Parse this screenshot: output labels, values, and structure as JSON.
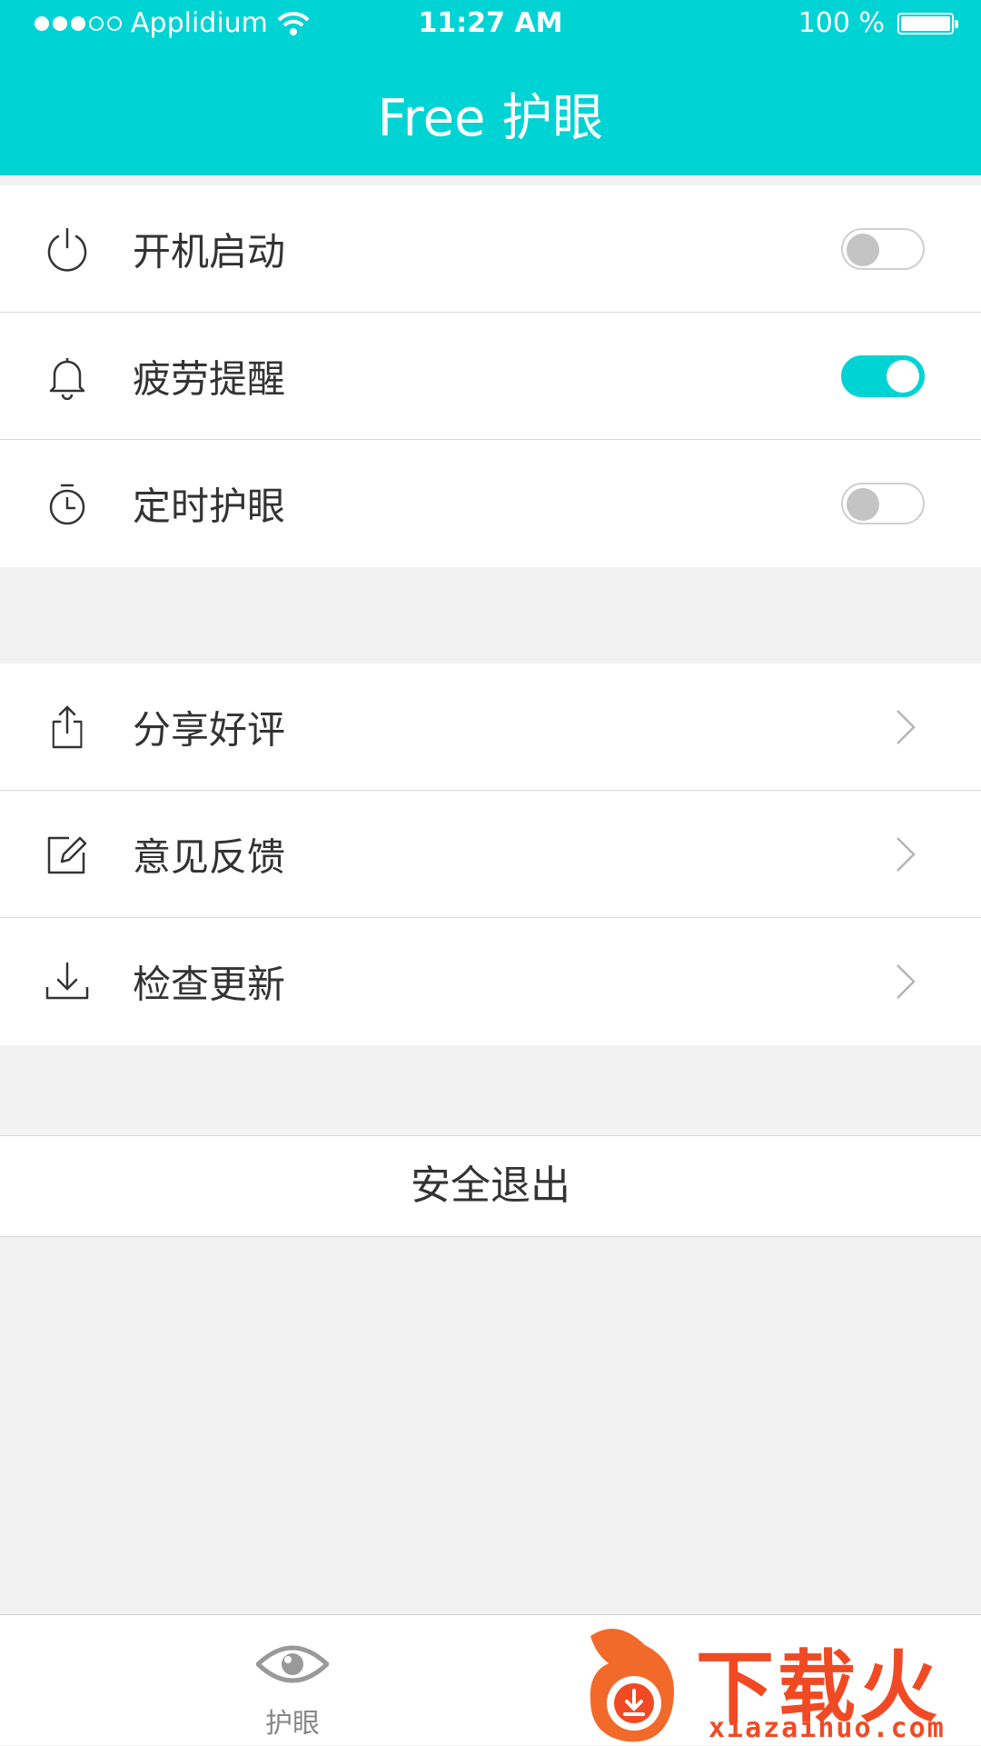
{
  "status_bar": {
    "carrier": "Applidium",
    "time": "11:27 AM",
    "battery": "100 %"
  },
  "header": {
    "title": "Free 护眼"
  },
  "settings": [
    {
      "label": "开机启动",
      "icon": "power-icon",
      "toggle_on": false
    },
    {
      "label": "疲劳提醒",
      "icon": "bell-icon",
      "toggle_on": true
    },
    {
      "label": "定时护眼",
      "icon": "timer-icon",
      "toggle_on": false
    }
  ],
  "actions": [
    {
      "label": "分享好评",
      "icon": "share-icon"
    },
    {
      "label": "意见反馈",
      "icon": "edit-icon"
    },
    {
      "label": "检查更新",
      "icon": "download-icon"
    }
  ],
  "logout": {
    "label": "安全退出"
  },
  "tab_bar": {
    "tabs": [
      {
        "label": "护眼",
        "icon": "eye-icon"
      }
    ]
  },
  "watermark": {
    "text": "下载火",
    "url": "xiazaihuo.com"
  },
  "colors": {
    "accent": "#00d3d4",
    "background": "#f2f2f2",
    "watermark": "#f04a24"
  }
}
